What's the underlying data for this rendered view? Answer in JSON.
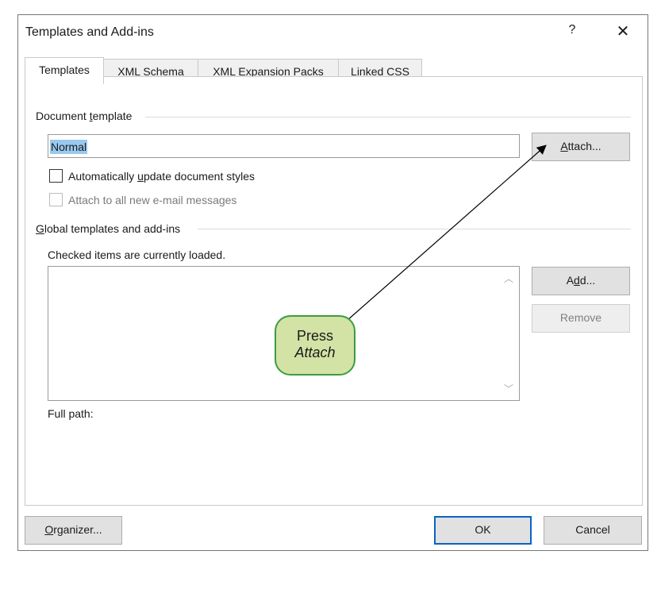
{
  "dialog": {
    "title": "Templates and Add-ins",
    "help_glyph": "?",
    "close_glyph": "✕"
  },
  "tabs": [
    {
      "label": "Templates",
      "active": true
    },
    {
      "label": "XML Schema",
      "active": false
    },
    {
      "label": "XML Expansion Packs",
      "active": false
    },
    {
      "label": "Linked CSS",
      "active": false
    }
  ],
  "document_template": {
    "group_label_pre": "Document ",
    "group_label_u": "t",
    "group_label_post": "emplate",
    "value": "Normal",
    "attach_pre": "",
    "attach_u": "A",
    "attach_post": "ttach...",
    "auto_update_pre": "Automatically ",
    "auto_update_u": "u",
    "auto_update_post": "pdate document styles",
    "auto_update_checked": false,
    "attach_email_label": "Attach to all new e-mail messages",
    "attach_email_enabled": false
  },
  "global_templates": {
    "group_label_u": "G",
    "group_label_post": "lobal templates and add-ins",
    "hint": "Checked items are currently loaded.",
    "items": [],
    "add_pre": "A",
    "add_u": "d",
    "add_post": "d...",
    "remove_label": "Remove",
    "remove_enabled": false,
    "full_path_label": "Full path:"
  },
  "footer": {
    "organizer_u": "O",
    "organizer_post": "rganizer...",
    "ok_label": "OK",
    "cancel_label": "Cancel"
  },
  "annotation": {
    "line1": "Press",
    "line2": "Attach",
    "fill_color": "#d3e2a5",
    "border_color": "#3b9d40"
  },
  "colors": {
    "selection": "#99c9ef",
    "default_button_border": "#0a63c5"
  },
  "icons": {
    "scroll_up": "chevron-up-icon",
    "scroll_down": "chevron-down-icon",
    "close": "close-icon"
  }
}
